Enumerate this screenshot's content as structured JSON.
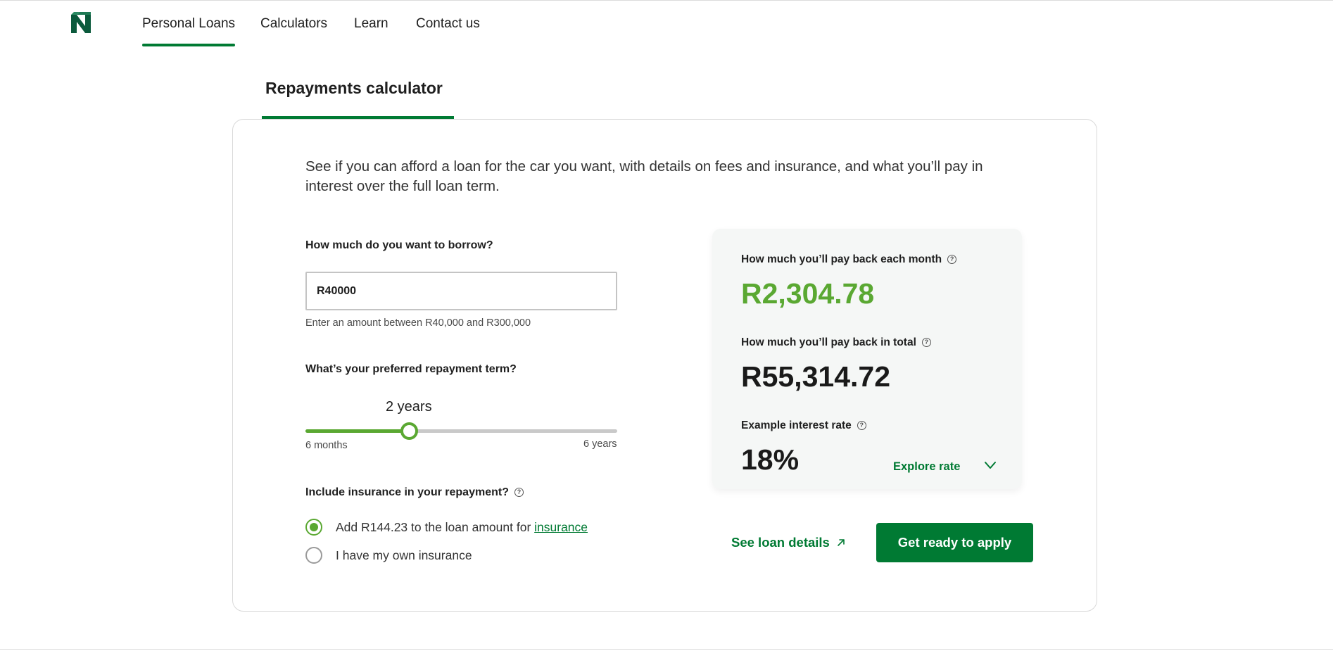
{
  "nav": {
    "items": [
      {
        "label": "Personal Loans",
        "active": true
      },
      {
        "label": "Calculators",
        "active": false
      },
      {
        "label": "Learn",
        "active": false
      },
      {
        "label": "Contact us",
        "active": false
      }
    ]
  },
  "calculator": {
    "tab_label": "Repayments calculator",
    "intro": "See if you can afford a loan for the car you want, with details on fees and insurance, and what you’ll pay in interest over the full loan term.",
    "borrow": {
      "label": "How much do you want to borrow?",
      "value": "R40000",
      "hint": "Enter an amount between R40,000 and R300,000"
    },
    "term": {
      "label": "What’s your preferred repayment term?",
      "value_label": "2 years",
      "min_label": "6 months",
      "max_label": "6 years",
      "fraction": 0.333
    },
    "insurance": {
      "label": "Include insurance in your repayment?",
      "option1_text": "Add R144.23 to the loan amount for ",
      "option1_link": "insurance",
      "option1_selected": true,
      "option2_text": "I have my own insurance",
      "option2_selected": false
    }
  },
  "results": {
    "monthly_label": "How much you’ll pay back each month",
    "monthly_value": "R2,304.78",
    "total_label": "How much you’ll pay back in total",
    "total_value": "R55,314.72",
    "rate_label": "Example interest rate",
    "rate_value": "18%",
    "explore_label": "Explore rate"
  },
  "actions": {
    "details_label": "See loan details",
    "apply_label": "Get ready to apply"
  },
  "colors": {
    "brand_green": "#007a33",
    "accent_green": "#5aa832"
  },
  "icons": [
    "nedbank-logo-icon",
    "help-icon",
    "chevron-down-icon",
    "external-arrow-icon"
  ]
}
